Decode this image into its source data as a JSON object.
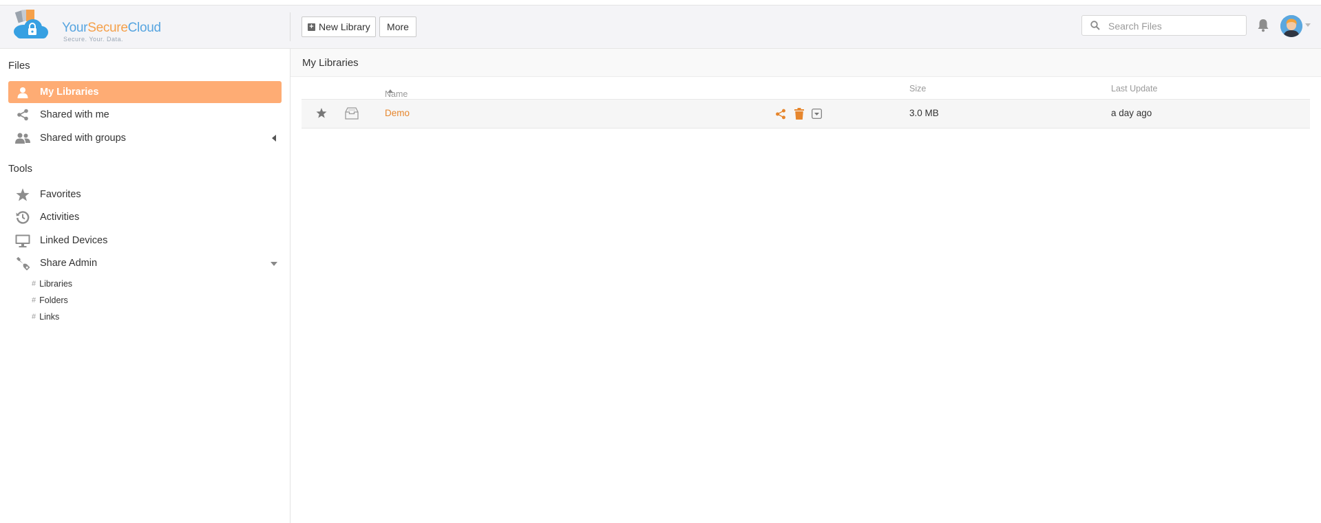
{
  "brand": {
    "name_part1": "Your",
    "name_part2": "Secure",
    "name_part3": "Cloud",
    "tagline": "Secure. Your. Data.",
    "colors": {
      "blue": "#57a5e0",
      "orange": "#f5a04a"
    }
  },
  "toolbar": {
    "new_library_label": "New Library",
    "more_label": "More"
  },
  "search": {
    "placeholder": "Search Files"
  },
  "sidebar": {
    "files_title": "Files",
    "files_items": [
      {
        "label": "My Libraries",
        "icon": "user-icon",
        "active": true
      },
      {
        "label": "Shared with me",
        "icon": "share-icon"
      },
      {
        "label": "Shared with groups",
        "icon": "group-icon"
      }
    ],
    "tools_title": "Tools",
    "tools_items": [
      {
        "label": "Favorites",
        "icon": "star-icon"
      },
      {
        "label": "Activities",
        "icon": "history-icon"
      },
      {
        "label": "Linked Devices",
        "icon": "monitor-icon"
      },
      {
        "label": "Share Admin",
        "icon": "wrench-icon"
      }
    ],
    "share_admin_sub": [
      "Libraries",
      "Folders",
      "Links"
    ],
    "active_color": "#feac74"
  },
  "main": {
    "title": "My Libraries",
    "columns": {
      "name": "Name",
      "size": "Size",
      "last_update": "Last Update"
    },
    "rows": [
      {
        "name": "Demo",
        "size": "3.0 MB",
        "last_update": "a day ago"
      }
    ],
    "link_color": "#e6862d"
  }
}
